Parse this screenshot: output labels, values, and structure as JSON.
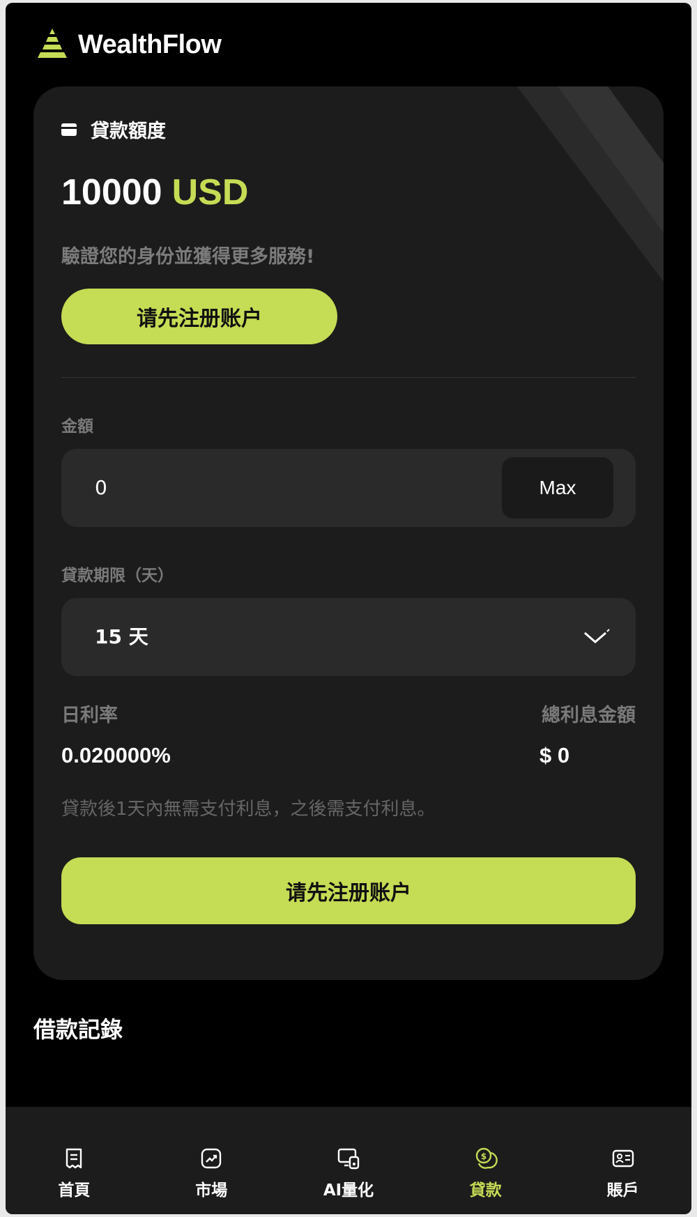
{
  "header": {
    "brand": "WealthFlow"
  },
  "loan_card": {
    "quota_label": "貸款額度",
    "quota_amount": "10000",
    "quota_currency": "USD",
    "verify_text": "驗證您的身份並獲得更多服務!",
    "register_button": "请先注册账户",
    "amount_label": "金額",
    "amount_value": "0",
    "max_button": "Max",
    "term_label": "貸款期限（天）",
    "term_value": "15 天",
    "daily_rate_label": "日利率",
    "daily_rate_value": "0.020000%",
    "total_interest_label": "總利息金額",
    "total_interest_value": "$ 0",
    "interest_note": "貸款後1天內無需支付利息，之後需支付利息。",
    "submit_button": "请先注册账户"
  },
  "records": {
    "title": "借款記錄"
  },
  "bottom_nav": {
    "items": [
      {
        "label": "首頁",
        "icon": "receipt-icon"
      },
      {
        "label": "市場",
        "icon": "chart-trend-icon"
      },
      {
        "label": "AI量化",
        "icon": "device-lock-icon"
      },
      {
        "label": "貸款",
        "icon": "coins-icon",
        "active": true
      },
      {
        "label": "賬戶",
        "icon": "id-card-icon"
      }
    ]
  },
  "colors": {
    "accent": "#c5dc55",
    "background": "#000000",
    "card": "#1c1c1c",
    "field": "#2a2a2a"
  }
}
